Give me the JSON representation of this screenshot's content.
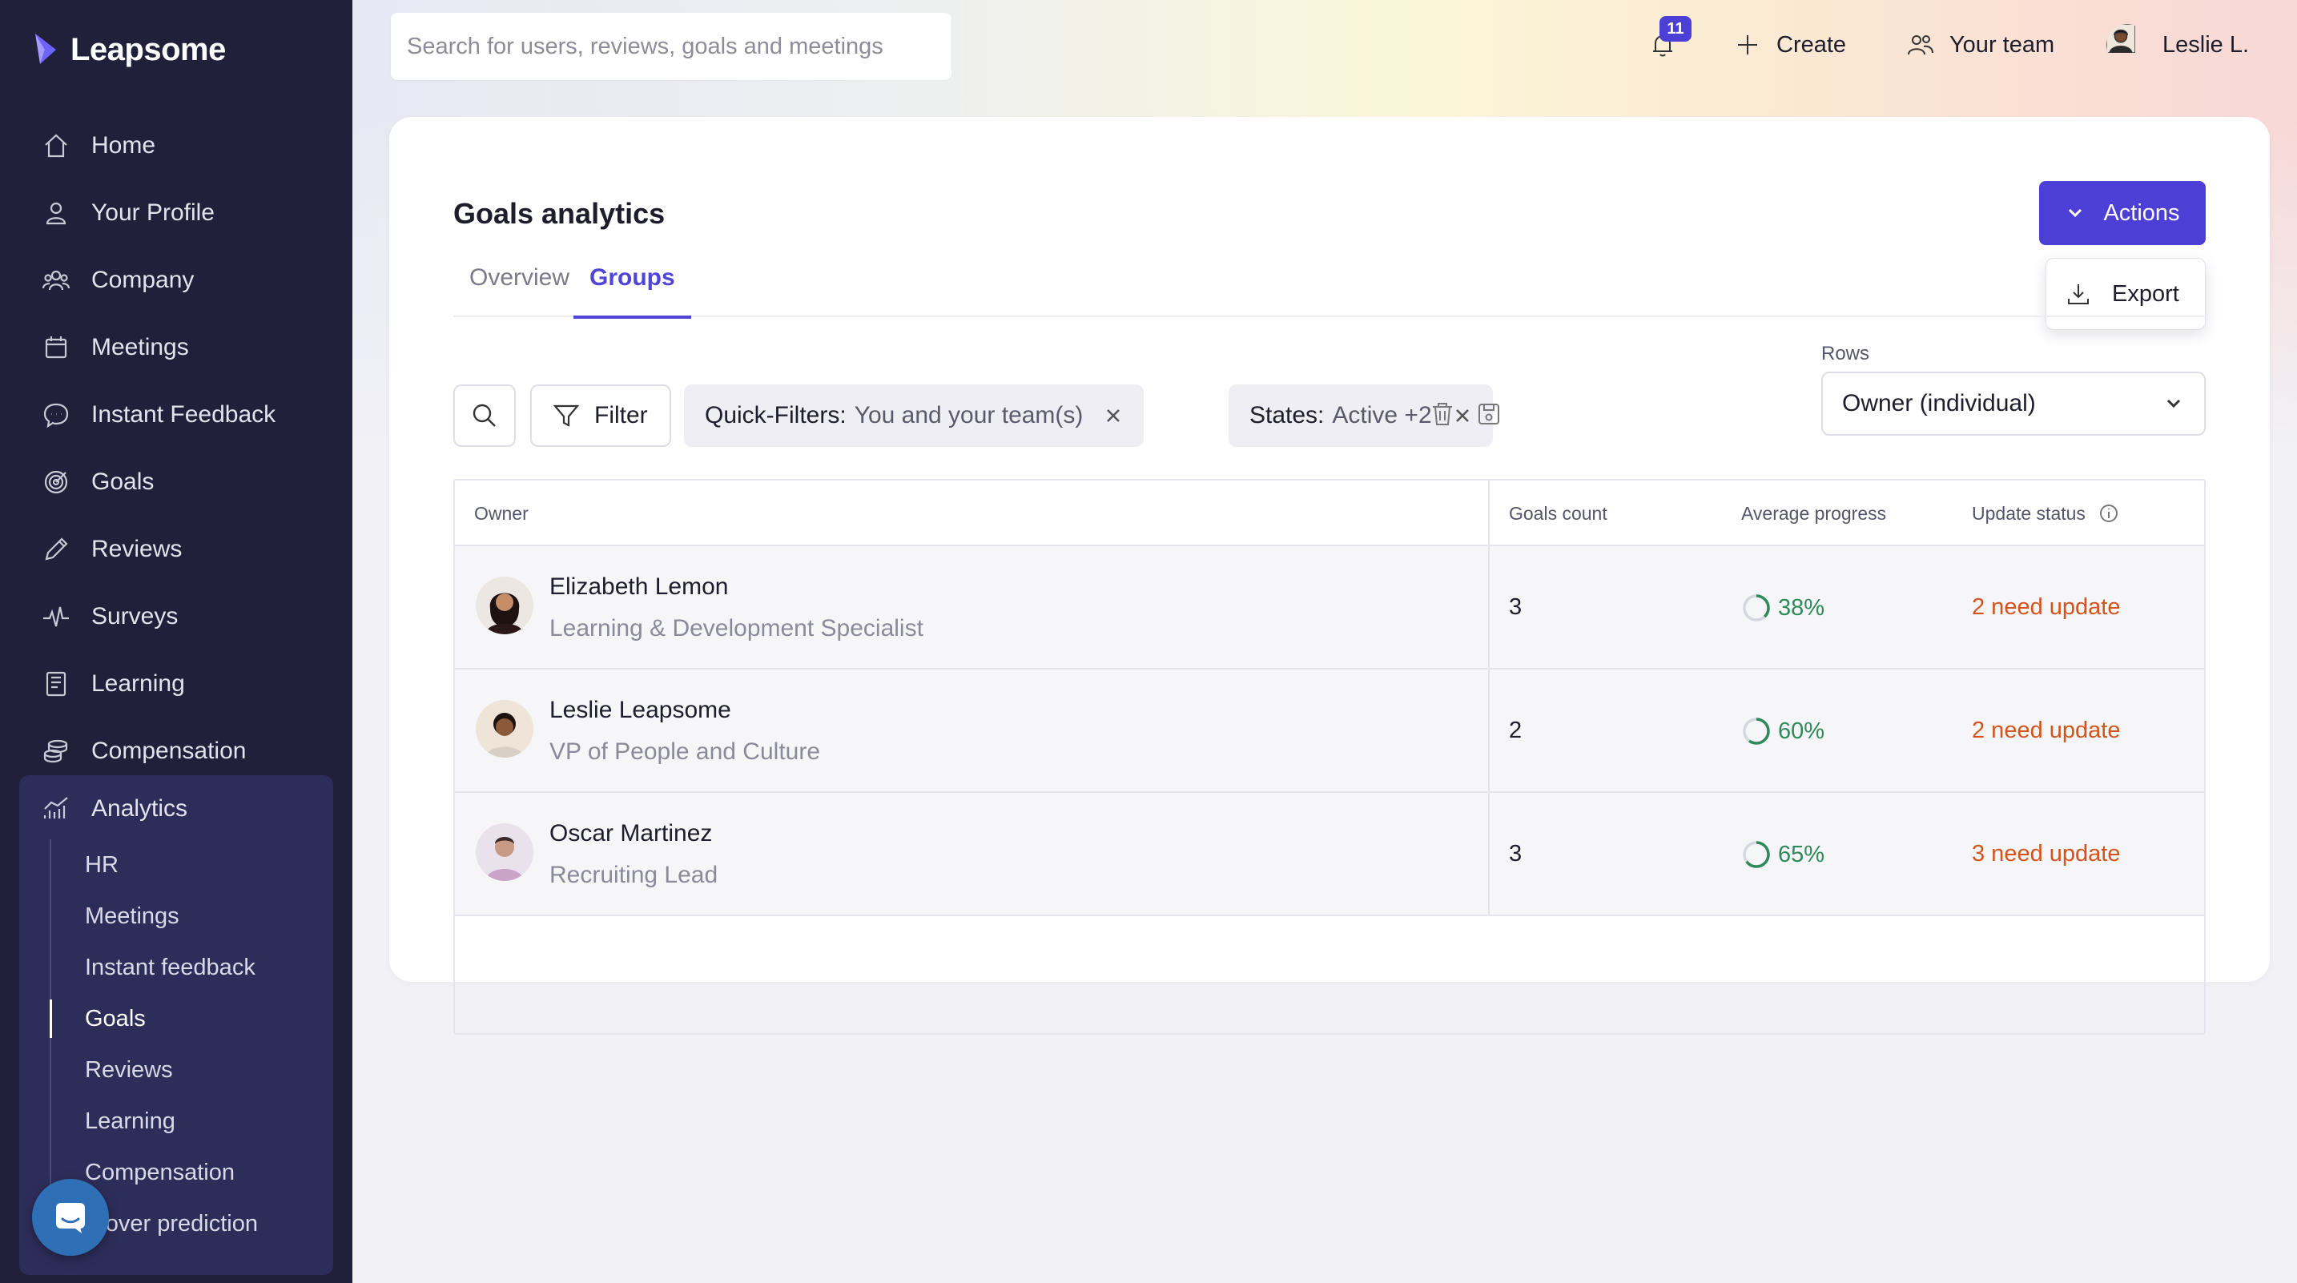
{
  "brand": {
    "name": "Leapsome"
  },
  "sidebar": {
    "items": [
      {
        "label": "Home",
        "icon": "home-icon"
      },
      {
        "label": "Your Profile",
        "icon": "user-icon"
      },
      {
        "label": "Company",
        "icon": "people-icon"
      },
      {
        "label": "Meetings",
        "icon": "calendar-icon"
      },
      {
        "label": "Instant Feedback",
        "icon": "chat-icon"
      },
      {
        "label": "Goals",
        "icon": "target-icon"
      },
      {
        "label": "Reviews",
        "icon": "pencil-icon"
      },
      {
        "label": "Surveys",
        "icon": "pulse-icon"
      },
      {
        "label": "Learning",
        "icon": "book-icon"
      },
      {
        "label": "Compensation",
        "icon": "coins-icon"
      }
    ],
    "analytics": {
      "label": "Analytics",
      "icon": "bar-chart-icon",
      "subitems": [
        "HR",
        "Meetings",
        "Instant feedback",
        "Goals",
        "Reviews",
        "Learning",
        "Compensation",
        "rnover prediction"
      ],
      "active": "Goals"
    }
  },
  "topbar": {
    "search_placeholder": "Search for users, reviews, goals and meetings",
    "notifications_count": "11",
    "create_label": "Create",
    "your_team_label": "Your team",
    "user_label": "Leslie L."
  },
  "page": {
    "title": "Goals analytics",
    "tabs": [
      "Overview",
      "Groups"
    ],
    "active_tab": "Groups",
    "actions_label": "Actions",
    "export_label": "Export"
  },
  "filters": {
    "filter_label": "Filter",
    "chips": [
      {
        "key": "Quick-Filters:",
        "value": "You and your team(s)"
      },
      {
        "key": "States:",
        "value": "Active +2"
      }
    ],
    "rows_label": "Rows",
    "rows_value": "Owner (individual)"
  },
  "table": {
    "columns": [
      "Owner",
      "Goals count",
      "Average progress",
      "Update status"
    ],
    "rows": [
      {
        "name": "Elizabeth Lemon",
        "title": "Learning & Development Specialist",
        "goals_count": "3",
        "progress_label": "38%",
        "progress": 0.38,
        "status": "2 need update"
      },
      {
        "name": "Leslie Leapsome",
        "title": "VP of People and Culture",
        "goals_count": "2",
        "progress_label": "60%",
        "progress": 0.6,
        "status": "2 need update"
      },
      {
        "name": "Oscar Martinez",
        "title": "Recruiting Lead",
        "goals_count": "3",
        "progress_label": "65%",
        "progress": 0.65,
        "status": "3 need update"
      }
    ]
  },
  "colors": {
    "sidebar_bg": "#20203a",
    "accent": "#4b3fd6",
    "progress_green": "#2e8a5a",
    "status_orange": "#d2541f"
  }
}
